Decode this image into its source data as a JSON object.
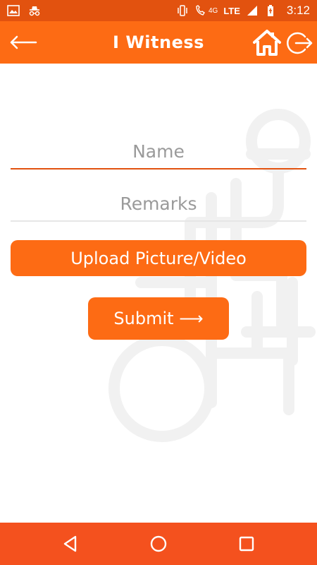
{
  "status_bar": {
    "network_label": "4G",
    "lte_label": "LTE",
    "time": "3:12",
    "icons": [
      "image-icon",
      "incognito-icon",
      "vibrate-icon",
      "wifi-calling-icon",
      "signal-icon",
      "battery-charging-icon"
    ]
  },
  "app_bar": {
    "title": "I Witness",
    "back_icon": "arrow-left-icon",
    "home_icon": "home-icon",
    "logout_icon": "logout-icon"
  },
  "form": {
    "name_placeholder": "Name",
    "remarks_placeholder": "Remarks",
    "upload_label": "Upload Picture/Video",
    "submit_label": "Submit ⟶"
  },
  "nav_bar": {
    "icons": [
      "back-triangle-icon",
      "home-circle-icon",
      "recents-square-icon"
    ]
  },
  "colors": {
    "status_bar": "#e2520f",
    "app_bar": "#fd6b14",
    "button": "#fd6b14",
    "nav_bar": "#f4511e",
    "input_active_underline": "#e2520f",
    "input_inactive_underline": "#e6e6e6",
    "placeholder_text": "#9a9a9a"
  }
}
